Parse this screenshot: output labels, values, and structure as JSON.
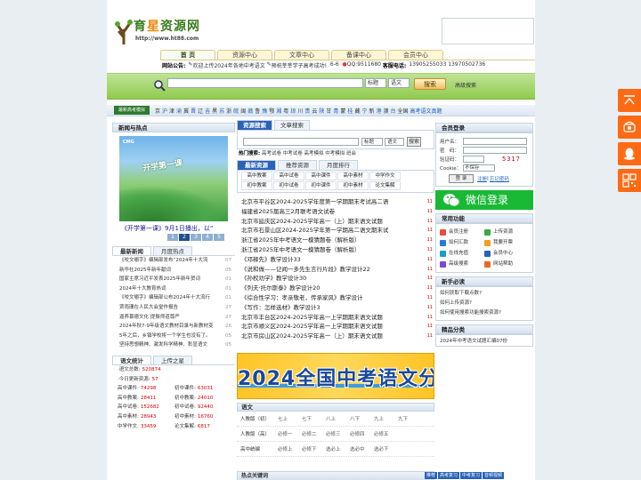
{
  "site": {
    "logo_text_a": "育",
    "logo_text_b": "星",
    "logo_text_c": "资源网",
    "logo_url": "http://www.ht88.com"
  },
  "nav": {
    "tabs": [
      {
        "label": "首 页"
      },
      {
        "label": "资源中心"
      },
      {
        "label": "文章中心"
      },
      {
        "label": "备课中心"
      },
      {
        "label": "会员中心"
      }
    ]
  },
  "notice": {
    "label": "网站公告:",
    "item1": "欢迎上传2024年各地中考语文",
    "item2": "预祝莘莘学子高考成功!",
    "date": "6-6",
    "qq": "QQ:9511680",
    "phone_label": "客服电话:",
    "phone": "13905255033 13970502736"
  },
  "search": {
    "select1": "标题",
    "select2": "语文",
    "button": "搜索",
    "advanced": "高级搜索"
  },
  "subjects": {
    "badge": "最新高考模拟",
    "items": [
      "京",
      "沪",
      "津",
      "渝",
      "冀",
      "晋",
      "辽",
      "吉",
      "黑",
      "苏",
      "浙",
      "皖",
      "闽",
      "赣",
      "鲁",
      "豫",
      "鄂",
      "湘",
      "粤",
      "琼",
      "川",
      "贵",
      "云",
      "陕",
      "甘",
      "青",
      "蒙",
      "桂",
      "藏",
      "宁",
      "新",
      "港",
      "澳",
      "台",
      "全国",
      "高考语文真题"
    ]
  },
  "left": {
    "news_title": "新闻与热点",
    "photo_cmg": "CMG",
    "photo_text": "开学第一课",
    "photo_caption": "《开学第一课》9月1日播出，以“",
    "pager": [
      "1",
      "2",
      "3",
      "4",
      "5"
    ],
    "tab_new": "最新新闻",
    "tab_hot": "月度热点",
    "news": [
      {
        "t": "《咬文嚼字》编辑部发布“2024年十大流",
        "n": "07"
      },
      {
        "t": "新华社2025年新年献词",
        "n": "05"
      },
      {
        "t": "国家主席习近平发表2025年新年贺词",
        "n": "01"
      },
      {
        "t": "2024年十大教育热词",
        "n": "01"
      },
      {
        "t": "《咬文嚼字》编辑部公布2024年十大流行",
        "n": "01"
      },
      {
        "t": "贾雨珊在人民大会堂作报告",
        "n": "27"
      },
      {
        "t": "逼养慕德文化 提振师道尊严",
        "n": "27"
      },
      {
        "t": "2024年秋7-9年级语文教材目录与新教材变",
        "n": "26"
      },
      {
        "t": "5年之后，乡镇学校将一个学生也没有了。",
        "n": "05"
      },
      {
        "t": "坚持思想精神、激发科学精神、彰显语文",
        "n": "05"
      }
    ],
    "stats_tab1": "语文统计",
    "stats_tab2": "上传之星",
    "stats": {
      "total_label": "·语文总数:",
      "total": "520874",
      "today_label": "·今日更新资源:",
      "today": "57",
      "r1": [
        {
          "l": "高中课件:",
          "v": "74298"
        },
        {
          "l": "初中课件:",
          "v": "63031"
        }
      ],
      "r2": [
        {
          "l": "高中教案:",
          "v": "28411"
        },
        {
          "l": "初中教案:",
          "v": "24010"
        }
      ],
      "r3": [
        {
          "l": "高中试卷:",
          "v": "152682"
        },
        {
          "l": "初中试卷:",
          "v": "92440"
        }
      ],
      "r4": [
        {
          "l": "高中素材:",
          "v": "28943"
        },
        {
          "l": "初中素材:",
          "v": "16760"
        }
      ],
      "r5": [
        {
          "l": "中学作文:",
          "v": "33459"
        },
        {
          "l": "论文集解:",
          "v": "6817"
        }
      ]
    }
  },
  "mid": {
    "tab_res": "资源搜索",
    "tab_art": "文章搜索",
    "sel1": "标题",
    "sel2": "语文",
    "btn": "搜索",
    "hot_label": "热门搜索:",
    "hot_items": "高考试卷 中考试卷 高考模拟 中考模拟 班会",
    "tab_latest": "最新资源",
    "tab_recommend": "推荐资源",
    "tab_monthly": "月度排行",
    "grid": [
      [
        "高中教案",
        "高中试卷",
        "高中课件",
        "高中素材",
        "中学作文"
      ],
      [
        "初中教案",
        "初中试卷",
        "初中课件",
        "初中素材",
        "论文集解"
      ]
    ],
    "articles": [
      {
        "t": "北京市平谷区2024-2025学年度第一学期期末考试高二语",
        "n": "11"
      },
      {
        "t": "福建省2025届高三2月联考语文试卷",
        "n": "11"
      },
      {
        "t": "北京市延庆区2024-2025学年高一（上）期末语文试题",
        "n": "11"
      },
      {
        "t": "北京市石景山区2024-2025学年第一学期高二语文期末试",
        "n": "11"
      },
      {
        "t": "浙江省2025年中考语文一模猜题卷（解析版）",
        "n": "11"
      },
      {
        "t": "浙江省2025年中考语文一模猜题卷（解析版）",
        "n": "11"
      },
      {
        "t": "《邓稼先》教学设计33",
        "n": "11"
      },
      {
        "t": "《说和做——记闻一多先生言行片段》教学设计22",
        "n": "11"
      },
      {
        "t": "《孙权劝学》教学设计30",
        "n": "11"
      },
      {
        "t": "《列夫·托尔斯泰》教学设计20",
        "n": "11"
      },
      {
        "t": "《综合性学习：孝亲敬老，传承家风》教学设计",
        "n": "11"
      },
      {
        "t": "《写作：怎样选材》教学设计3",
        "n": "11"
      },
      {
        "t": "北京市丰台区2024-2025学年高一上学期期末语文试题",
        "n": "11"
      },
      {
        "t": "北京市顺义区2024-2025学年高一上学期期末语文试题",
        "n": "11"
      },
      {
        "t": "北京市房山区2024-2025学年高一（上）期末语文试题",
        "n": "11"
      }
    ],
    "banner": "2024全国中考语文分类汇编",
    "yw_title": "语文",
    "yw_rows": [
      {
        "l": "人教版（初）",
        "items": [
          "七上",
          "七下",
          "八上",
          "八下",
          "九上",
          "九下"
        ]
      },
      {
        "l": "人教版（高）",
        "items": [
          "必修一",
          "必修二",
          "必修三",
          "必修四",
          "必修五"
        ]
      },
      {
        "l": "高中统编",
        "items": [
          "必修上",
          "必修下",
          "选必上",
          "选必中",
          "选必下"
        ]
      }
    ],
    "hotwords": "热点关键词",
    "hot_tags": [
      "推荐",
      "高考复习",
      "中考复习",
      "音频视频"
    ]
  },
  "right": {
    "login_title": "会员登录",
    "user_label": "用户名：",
    "pwd_label": "密　码：",
    "code_label": "验证码：",
    "captcha": "5317",
    "cookie_label": "Cookie：",
    "cookie_val": "不保存",
    "login_btn": "登 录",
    "register": "注册",
    "forgot": "忘记密码",
    "wechat": "微信登录",
    "func_title": "常用功能",
    "funcs": [
      "会员注册",
      "上传资源",
      "如何汇款",
      "我要开票",
      "在线充值",
      "会员中心",
      "高级搜索",
      "网站帮助"
    ],
    "help_title": "新手必读",
    "help": [
      "如何获取下载点数?",
      "如何上传资源?",
      "如何使用搜索功能搜索资源?"
    ],
    "best_title": "精品分类",
    "best_item": "2024年中考语文试题汇编07份"
  },
  "colors": {
    "brand_green": "#3a7d1e",
    "brand_orange": "#e88a10",
    "float_orange": "#ff6a12",
    "wechat_green": "#19b935",
    "tab_blue": "#2a62b8"
  }
}
